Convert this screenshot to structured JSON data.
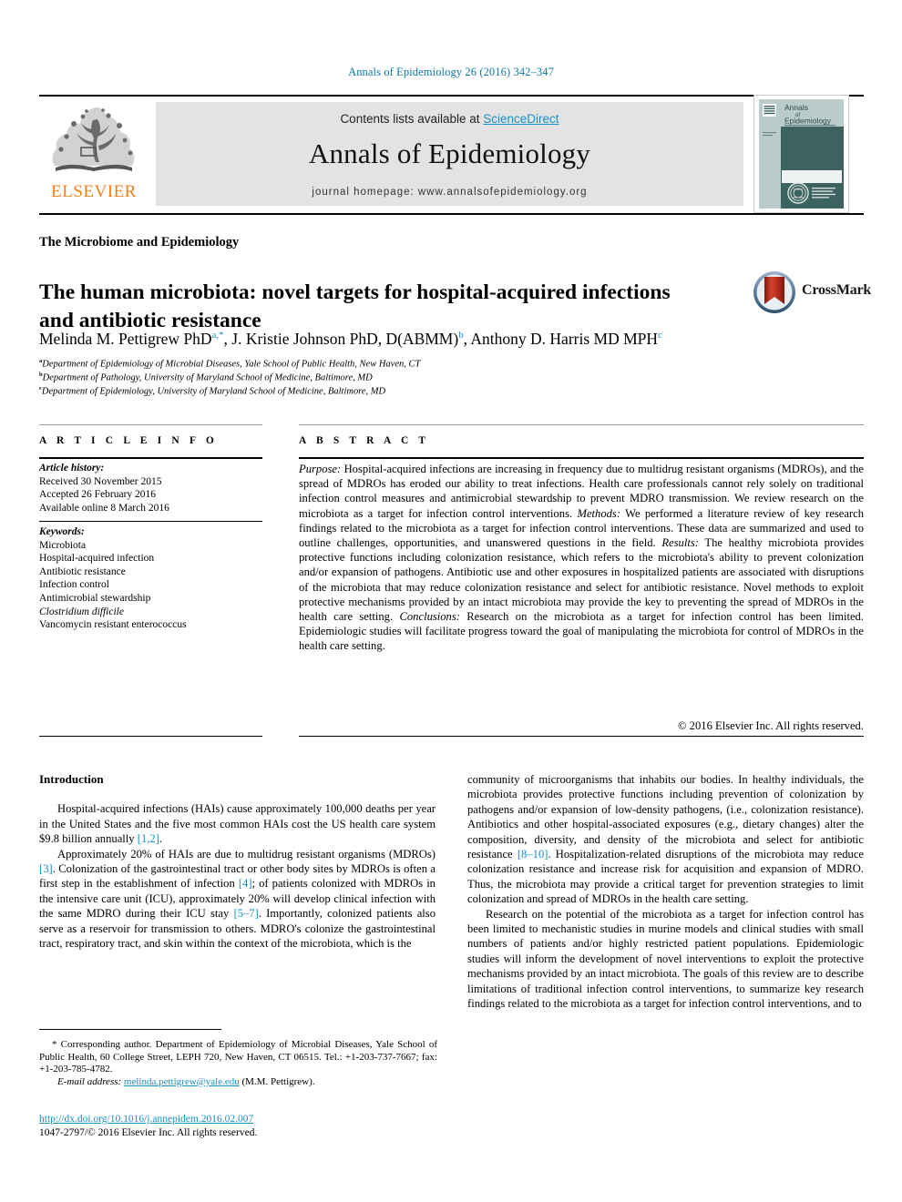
{
  "running_head": "Annals of Epidemiology 26 (2016) 342–347",
  "masthead": {
    "publisher_name": "ELSEVIER",
    "publisher_logo_icon": "elsevier-tree-icon",
    "contents_prefix": "Contents lists available at ",
    "contents_link": "ScienceDirect",
    "journal_title": "Annals of Epidemiology",
    "homepage": "journal homepage: www.annalsofepidemiology.org",
    "cover": {
      "line1": "Annals",
      "line2": "of",
      "line3": "Epidemiology",
      "seal_icon": "acp-seal-icon",
      "emblem_icon": "journal-emblem-icon"
    },
    "colors": {
      "link": "#1b8ec4",
      "elsevier_orange": "#f07f1a",
      "box_background": "#e3e3e3",
      "cover_teal": "#3d6360"
    }
  },
  "section_label": "The Microbiome and Epidemiology",
  "article_title": "The human microbiota: novel targets for hospital-acquired infections and antibiotic resistance",
  "crossmark": {
    "label": "CrossMark",
    "icon": "crossmark-badge-icon"
  },
  "authors": {
    "list": [
      {
        "name": "Melinda M. Pettigrew PhD",
        "marks": "a,*"
      },
      {
        "name": "J. Kristie Johnson PhD, D(ABMM)",
        "marks": "b"
      },
      {
        "name": "Anthony D. Harris MD MPH",
        "marks": "c"
      }
    ],
    "affiliations": [
      {
        "mark": "a",
        "text": "Department of Epidemiology of Microbial Diseases, Yale School of Public Health, New Haven, CT"
      },
      {
        "mark": "b",
        "text": "Department of Pathology, University of Maryland School of Medicine, Baltimore, MD"
      },
      {
        "mark": "c",
        "text": "Department of Epidemiology, University of Maryland School of Medicine, Baltimore, MD"
      }
    ]
  },
  "article_info": {
    "heading": "A R T I C L E  I N F O",
    "history_label": "Article history:",
    "history": [
      "Received 30 November 2015",
      "Accepted 26 February 2016",
      "Available online 8 March 2016"
    ],
    "keywords_label": "Keywords:",
    "keywords": [
      "Microbiota",
      "Hospital-acquired infection",
      "Antibiotic resistance",
      "Infection control",
      "Antimicrobial stewardship",
      "Clostridium difficile",
      "Vancomycin resistant enterococcus"
    ],
    "italic_keywords": [
      "Clostridium difficile"
    ]
  },
  "abstract": {
    "heading": "A B S T R A C T",
    "sections": [
      {
        "label": "Purpose:",
        "text": " Hospital-acquired infections are increasing in frequency due to multidrug resistant organisms (MDROs), and the spread of MDROs has eroded our ability to treat infections. Health care professionals cannot rely solely on traditional infection control measures and antimicrobial stewardship to prevent MDRO transmission. We review research on the microbiota as a target for infection control interventions."
      },
      {
        "label": "Methods:",
        "text": " We performed a literature review of key research findings related to the microbiota as a target for infection control interventions. These data are summarized and used to outline challenges, opportunities, and unanswered questions in the field."
      },
      {
        "label": "Results:",
        "text": " The healthy microbiota provides protective functions including colonization resistance, which refers to the microbiota's ability to prevent colonization and/or expansion of pathogens. Antibiotic use and other exposures in hospitalized patients are associated with disruptions of the microbiota that may reduce colonization resistance and select for antibiotic resistance. Novel methods to exploit protective mechanisms provided by an intact microbiota may provide the key to preventing the spread of MDROs in the health care setting."
      },
      {
        "label": "Conclusions:",
        "text": " Research on the microbiota as a target for infection control has been limited. Epidemiologic studies will facilitate progress toward the goal of manipulating the microbiota for control of MDROs in the health care setting."
      }
    ],
    "copyright": "© 2016 Elsevier Inc. All rights reserved."
  },
  "body": {
    "left_heading": "Introduction",
    "left_paragraphs": [
      {
        "parts": [
          {
            "t": "Hospital-acquired infections (HAIs) cause approximately 100,000 deaths per year in the United States and the five most common HAIs cost the US health care system $9.8 billion annually "
          },
          {
            "t": "[1,2]",
            "ref": true
          },
          {
            "t": "."
          }
        ]
      },
      {
        "parts": [
          {
            "t": "Approximately 20% of HAIs are due to multidrug resistant organisms (MDROs) "
          },
          {
            "t": "[3]",
            "ref": true
          },
          {
            "t": ". Colonization of the gastrointestinal tract or other body sites by MDROs is often a first step in the establishment of infection "
          },
          {
            "t": "[4]",
            "ref": true
          },
          {
            "t": "; of patients colonized with MDROs in the intensive care unit (ICU), approximately 20% will develop clinical infection with the same MDRO during their ICU stay "
          },
          {
            "t": "[5–7]",
            "ref": true
          },
          {
            "t": ". Importantly, colonized patients also serve as a reservoir for transmission to others. MDRO's colonize the gastrointestinal tract, respiratory tract, and skin within the context of the microbiota, which is the"
          }
        ]
      }
    ],
    "right_paragraphs": [
      {
        "no_indent": true,
        "parts": [
          {
            "t": "community of microorganisms that inhabits our bodies. In healthy individuals, the microbiota provides protective functions including prevention of colonization by pathogens and/or expansion of low-density pathogens, (i.e., colonization resistance). Antibiotics and other hospital-associated exposures (e.g., dietary changes) alter the composition, diversity, and density of the microbiota and select for antibiotic resistance "
          },
          {
            "t": "[8–10]",
            "ref": true
          },
          {
            "t": ". Hospitalization-related disruptions of the microbiota may reduce colonization resistance and increase risk for acquisition and expansion of MDRO. Thus, the microbiota may provide a critical target for prevention strategies to limit colonization and spread of MDROs in the health care setting."
          }
        ]
      },
      {
        "parts": [
          {
            "t": "Research on the potential of the microbiota as a target for infection control has been limited to mechanistic studies in murine models and clinical studies with small numbers of patients and/or highly restricted patient populations. Epidemiologic studies will inform the development of novel interventions to exploit the protective mechanisms provided by an intact microbiota. The goals of this review are to describe limitations of traditional infection control interventions, to summarize key research findings related to the microbiota as a target for infection control interventions, and to"
          }
        ]
      }
    ]
  },
  "footnotes": {
    "corresponding": "* Corresponding author. Department of Epidemiology of Microbial Diseases, Yale School of Public Health, 60 College Street, LEPH 720, New Haven, CT 06515. Tel.: +1-203-737-7667; fax: +1-203-785-4782.",
    "email_label": "E-mail address:",
    "email": "melinda.pettigrew@yale.edu",
    "email_suffix": " (M.M. Pettigrew).",
    "doi": "http://dx.doi.org/10.1016/j.annepidem.2016.02.007",
    "issn_line": "1047-2797/© 2016 Elsevier Inc. All rights reserved."
  }
}
